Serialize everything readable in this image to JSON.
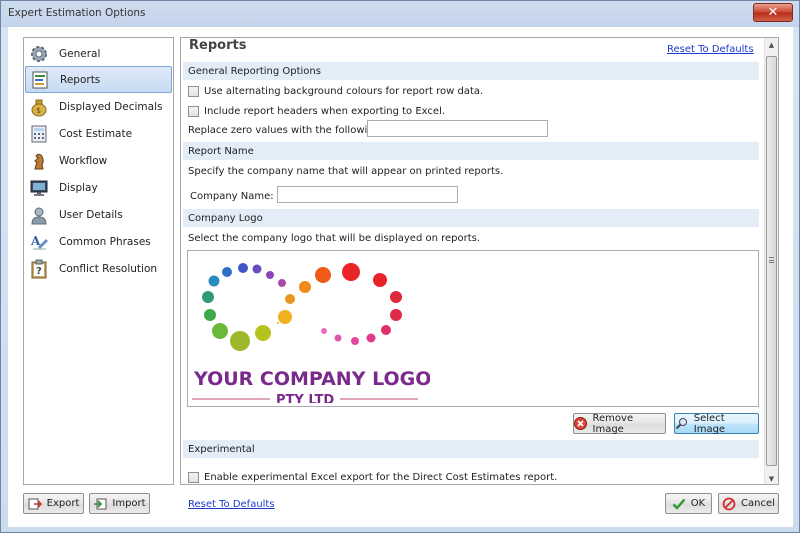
{
  "window": {
    "title": "Expert Estimation Options",
    "close_glyph": "✕"
  },
  "sidebar": {
    "items": [
      {
        "label": "General",
        "icon": "gear-icon"
      },
      {
        "label": "Reports",
        "icon": "report-icon",
        "selected": true
      },
      {
        "label": "Displayed Decimals",
        "icon": "money-bag-icon"
      },
      {
        "label": "Cost Estimate",
        "icon": "calculator-icon"
      },
      {
        "label": "Workflow",
        "icon": "chess-piece-icon"
      },
      {
        "label": "Display",
        "icon": "monitor-icon"
      },
      {
        "label": "User Details",
        "icon": "user-icon"
      },
      {
        "label": "Common Phrases",
        "icon": "text-phrase-icon"
      },
      {
        "label": "Conflict Resolution",
        "icon": "clipboard-question-icon"
      }
    ]
  },
  "reports": {
    "title": "Reports",
    "reset_link": "Reset To Defaults",
    "general": {
      "header": "General Reporting Options",
      "alt_bg_label": "Use alternating background colours for report row data.",
      "alt_bg_checked": false,
      "headers_label": "Include report headers when exporting to Excel.",
      "headers_checked": false,
      "zero_label": "Replace zero values with the following text",
      "zero_value": ""
    },
    "name": {
      "header": "Report Name",
      "description": "Specify the company name that will appear on printed reports.",
      "company_label": "Company Name:",
      "company_value": ""
    },
    "logo": {
      "header": "Company Logo",
      "description": "Select the company logo that will be displayed on reports.",
      "logo_text": "YOUR COMPANY LOGO",
      "logo_subtext": "PTY LTD",
      "remove_label": "Remove Image",
      "select_label": "Select Image"
    },
    "experimental": {
      "header": "Experimental",
      "excel_label": "Enable experimental Excel export for the Direct Cost Estimates report.",
      "excel_checked": false
    }
  },
  "footer": {
    "export_label": "Export",
    "import_label": "Import",
    "reset_link": "Reset To Defaults",
    "ok_label": "OK",
    "cancel_label": "Cancel"
  }
}
